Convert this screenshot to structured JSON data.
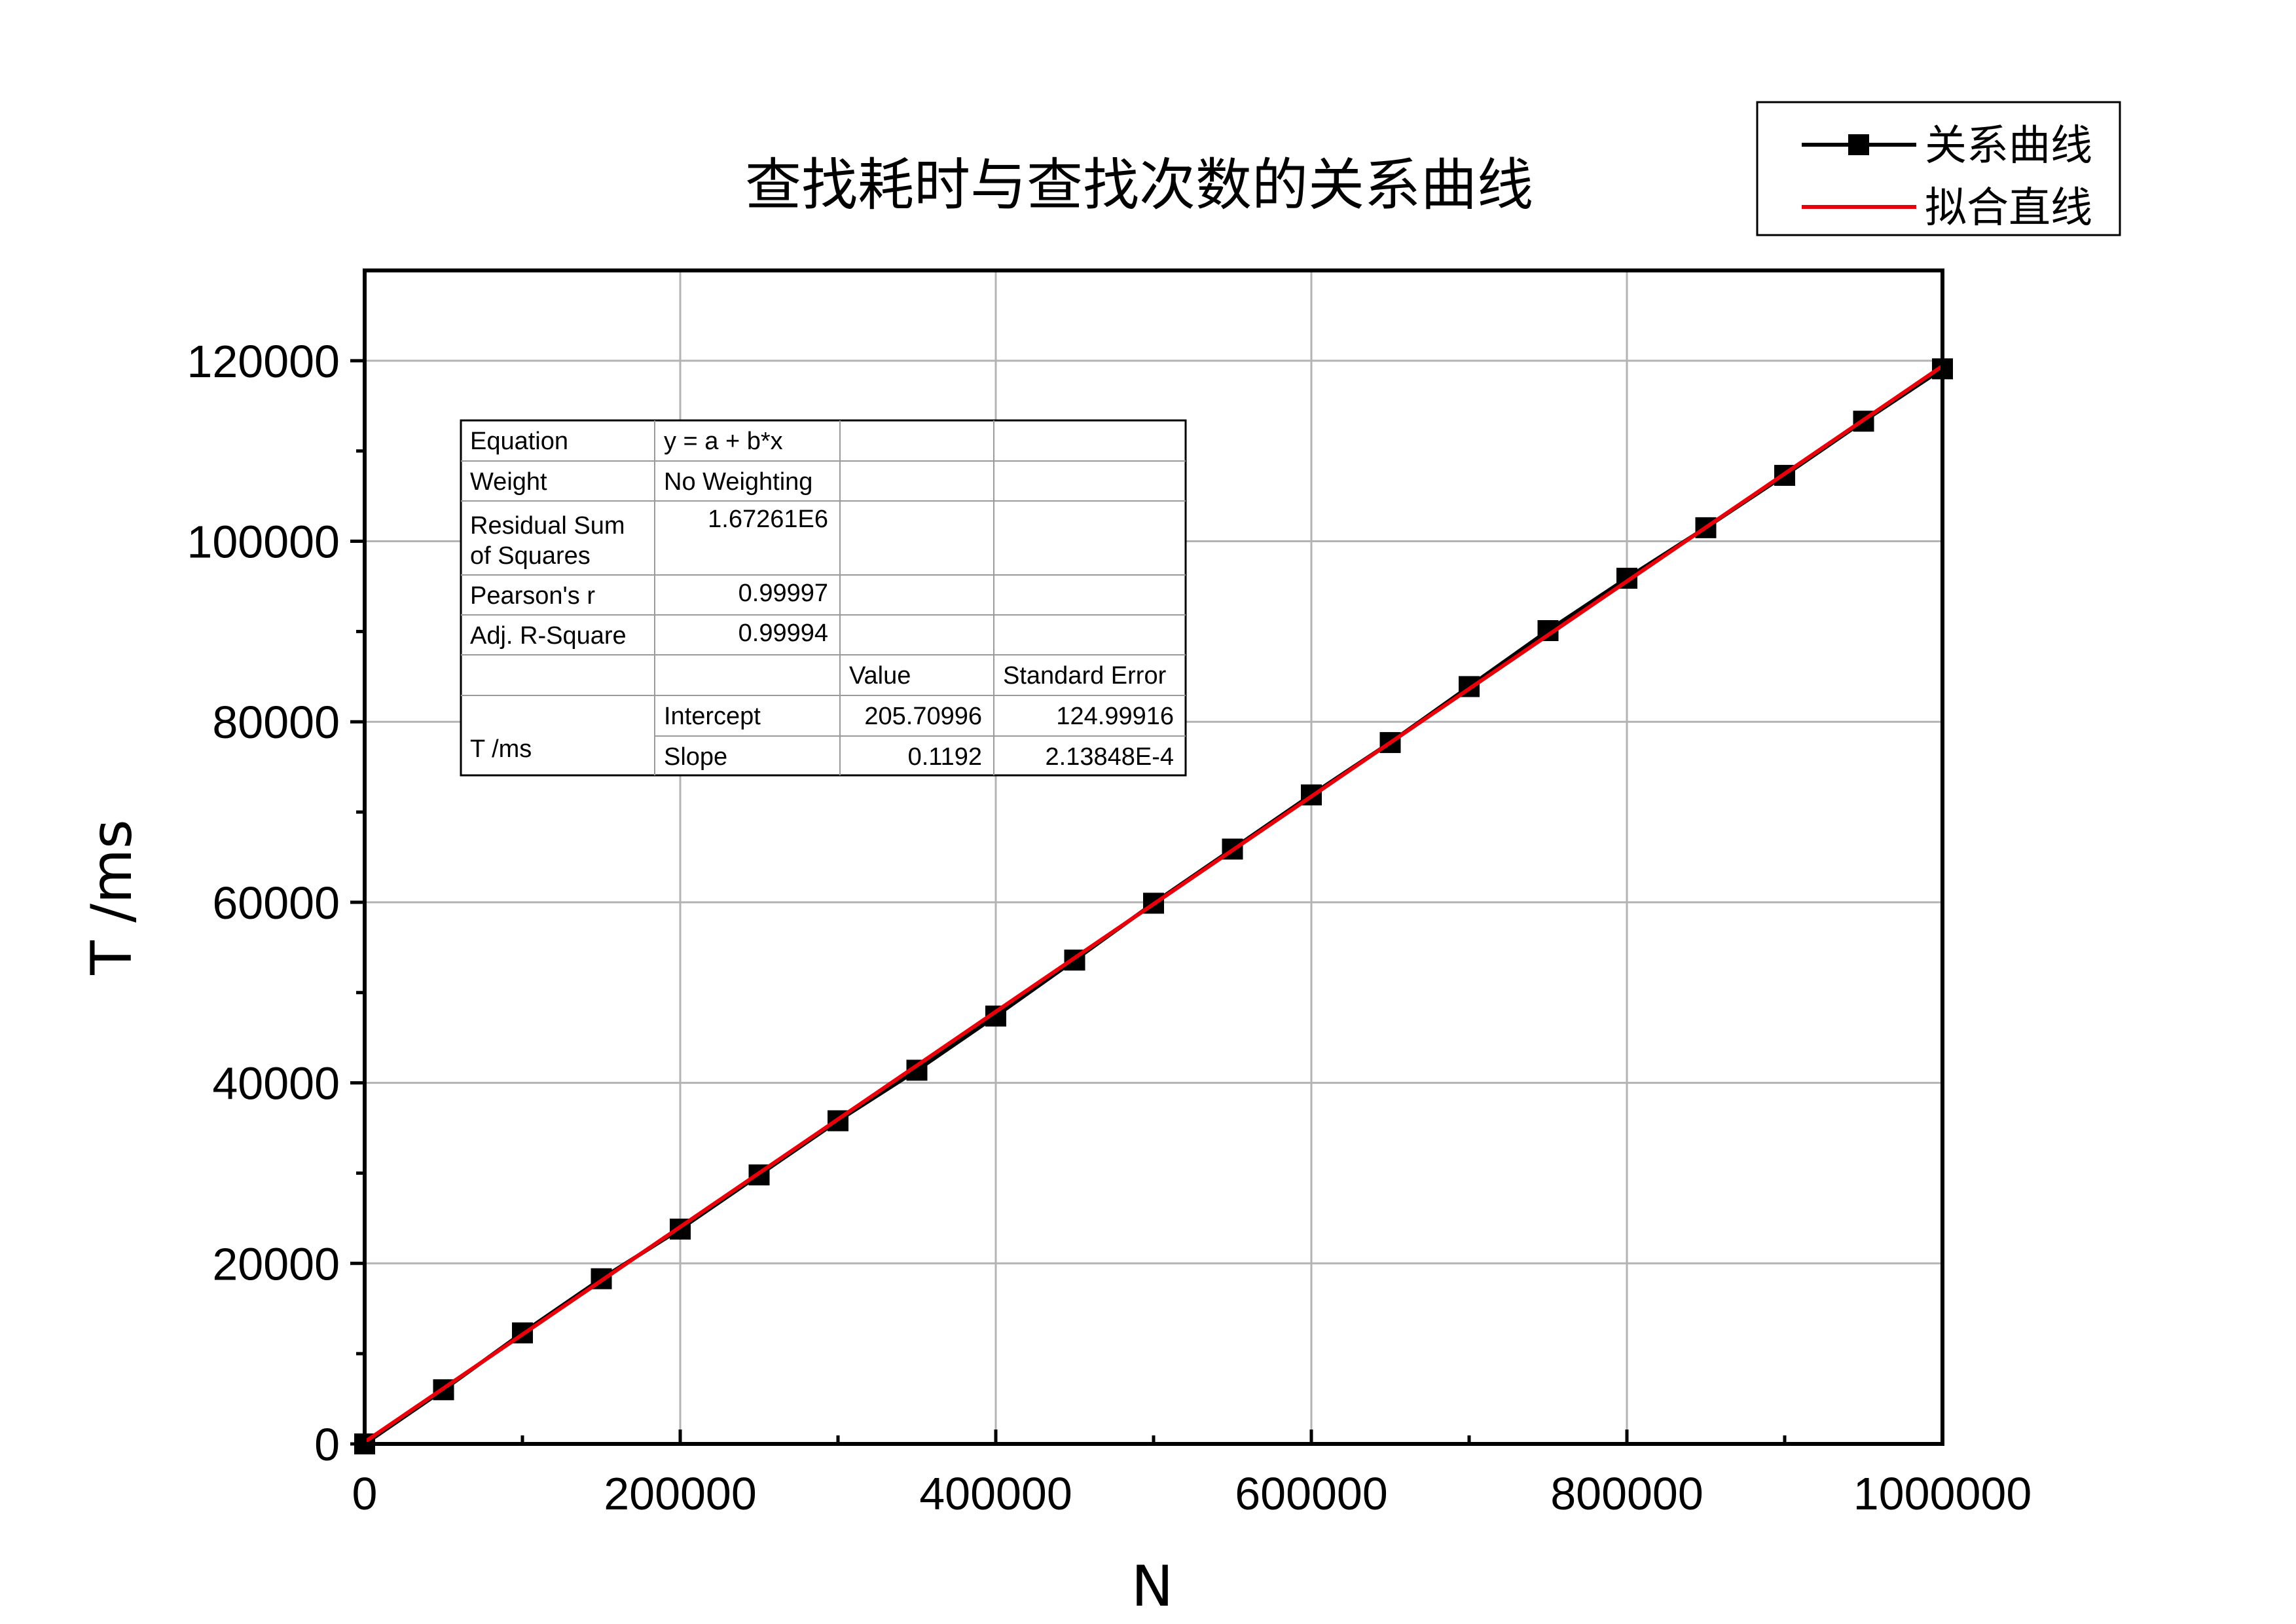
{
  "chart_data": {
    "type": "line",
    "title": "查找耗时与查找次数的关系曲线",
    "xlabel": "N",
    "ylabel": "T /ms",
    "xlim": [
      0,
      1000000
    ],
    "ylim": [
      0,
      130000
    ],
    "grid": true,
    "legend_position": "top-right",
    "x_ticks": [
      "0",
      "200000",
      "400000",
      "600000",
      "800000",
      "1000000"
    ],
    "y_ticks": [
      "0",
      "20000",
      "40000",
      "60000",
      "80000",
      "100000",
      "120000"
    ],
    "series": [
      {
        "name": "关系曲线",
        "color": "#000000",
        "marker": "square",
        "x": [
          0,
          50000,
          100000,
          150000,
          200000,
          250000,
          300000,
          350000,
          400000,
          450000,
          500000,
          550000,
          600000,
          650000,
          700000,
          750000,
          800000,
          850000,
          900000,
          950000,
          1000000
        ],
        "y": [
          0,
          6000,
          12300,
          18300,
          23800,
          29800,
          35800,
          41400,
          47400,
          53600,
          59900,
          65900,
          71900,
          77700,
          83900,
          90100,
          95900,
          101500,
          107300,
          113300,
          119100
        ]
      },
      {
        "name": "拟合直线",
        "color": "#e8000b",
        "x": [
          0,
          1000000
        ],
        "y": [
          205.70996,
          119405.71
        ]
      }
    ],
    "stats_table": {
      "rows": [
        [
          "Equation",
          "y = a + b*x",
          "",
          ""
        ],
        [
          "Weight",
          "No Weighting",
          "",
          ""
        ],
        [
          "Residual Sum|of Squares",
          "1.67261E6",
          "",
          ""
        ],
        [
          "Pearson's r",
          "0.99997",
          "",
          ""
        ],
        [
          "Adj. R-Square",
          "0.99994",
          "",
          ""
        ],
        [
          "",
          "",
          "Value",
          "Standard Error"
        ],
        [
          "T /ms",
          "Intercept",
          "205.70996",
          "124.99916"
        ],
        [
          "",
          "Slope",
          "0.1192",
          "2.13848E-4"
        ]
      ]
    }
  }
}
